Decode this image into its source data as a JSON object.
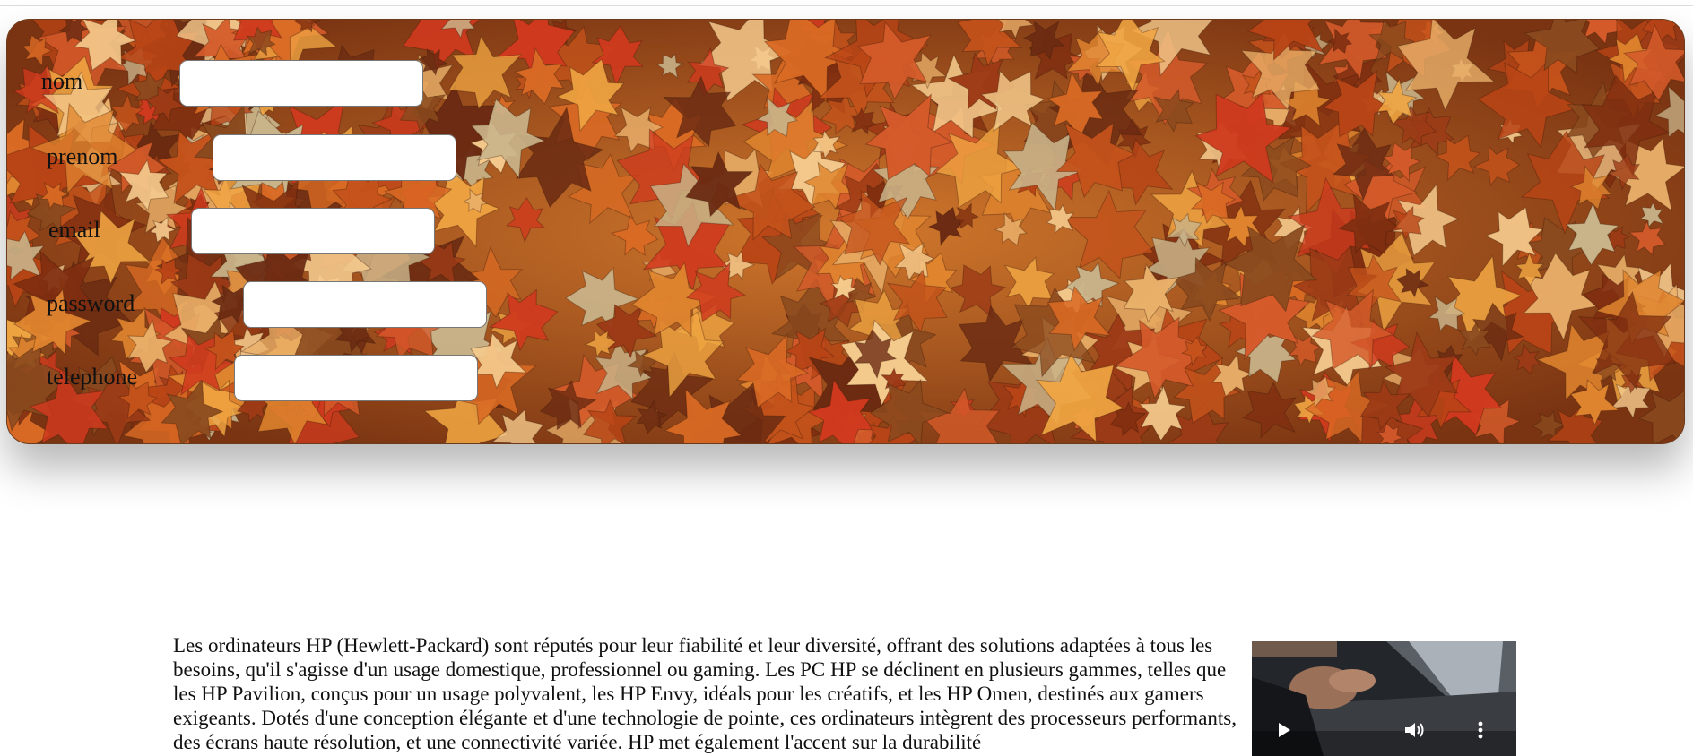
{
  "form": {
    "fields": [
      {
        "label": "nom",
        "value": "",
        "type": "text"
      },
      {
        "label": "prenom",
        "value": "",
        "type": "text"
      },
      {
        "label": "email",
        "value": "",
        "type": "email"
      },
      {
        "label": "password",
        "value": "",
        "type": "password"
      },
      {
        "label": "telephone",
        "value": "",
        "type": "tel"
      }
    ]
  },
  "article": {
    "text": "Les ordinateurs HP (Hewlett-Packard) sont réputés pour leur fiabilité et leur diversité, offrant des solutions adaptées à tous les besoins, qu'il s'agisse d'un usage domestique, professionnel ou gaming. Les PC HP se déclinent en plusieurs gammes, telles que les HP Pavilion, conçus pour un usage polyvalent, les HP Envy, idéals pour les créatifs, et les HP Omen, destinés aux gamers exigeants. Dotés d'une conception élégante et d'une technologie de pointe, ces ordinateurs intègrent des processeurs performants, des écrans haute résolution, et une connectivité variée. HP met également l'accent sur la durabilité"
  },
  "video": {
    "controls": [
      "play-icon",
      "volume-icon",
      "more-vertical-icon"
    ],
    "colors": {
      "controls": "#ffffff"
    }
  },
  "colors": {
    "panel_base": "#a9531c",
    "label_text": "#111111",
    "body_text": "#111111"
  }
}
